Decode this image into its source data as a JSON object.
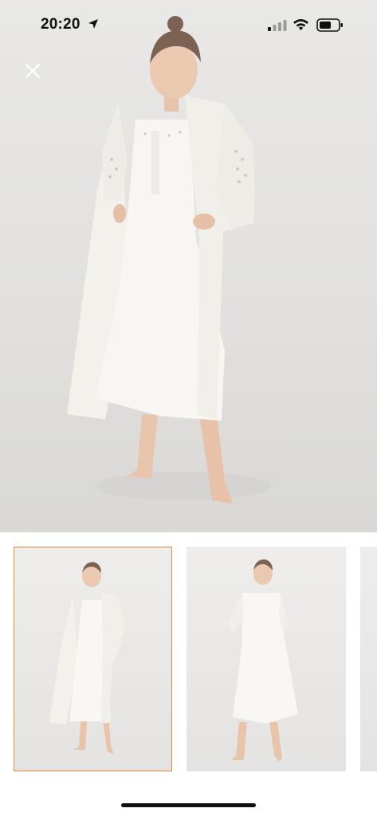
{
  "status_bar": {
    "time": "20:20",
    "icons": [
      "location-arrow-icon",
      "cellular-signal-icon",
      "wifi-icon",
      "battery-icon"
    ]
  },
  "viewer": {
    "close_icon": "close-icon",
    "main_image": "model-in-white-nightgown-and-robe",
    "selected_thumbnail_index": 0
  },
  "thumbnails": [
    {
      "image": "model-in-white-robe-set",
      "selected": true
    },
    {
      "image": "model-in-white-nightgown",
      "selected": false
    },
    {
      "image": "partial-thumbnail",
      "selected": false
    }
  ],
  "colors": {
    "selected_border": "#e08a3c",
    "background": "#ffffff",
    "status_text": "#111111"
  }
}
